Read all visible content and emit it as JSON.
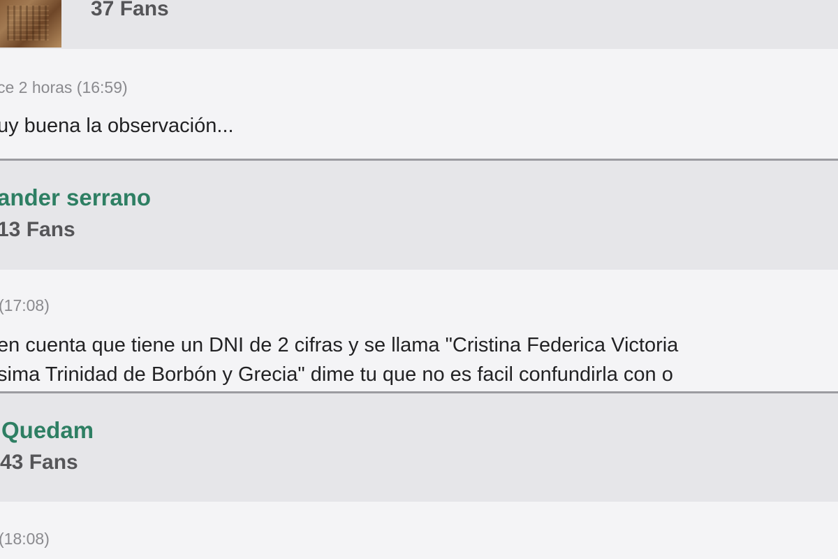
{
  "users": [
    {
      "name": "",
      "fans": "37 Fans"
    },
    {
      "name": "ander serrano",
      "fans": "13 Fans"
    },
    {
      "name": "Quedam",
      "fans": "43 Fans"
    }
  ],
  "comments": [
    {
      "time": "ce 2 horas (16:59)",
      "lines": [
        "uy buena la observación..."
      ]
    },
    {
      "time": "(17:08)",
      "lines": [
        "en cuenta que tiene un DNI de 2 cifras y se llama \"Cristina Federica Victoria",
        "sima Trinidad de Borbón y Grecia\" dime tu que no es facil confundirla con o"
      ]
    },
    {
      "time": "(18:08)",
      "lines": []
    }
  ]
}
